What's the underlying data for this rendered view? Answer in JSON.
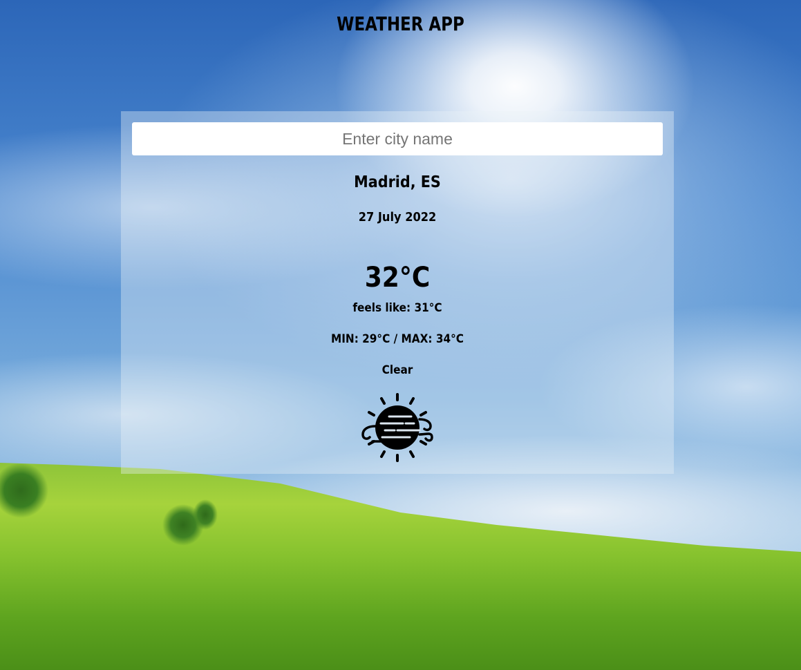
{
  "app": {
    "title": "WEATHER APP"
  },
  "search": {
    "placeholder": "Enter city name",
    "value": ""
  },
  "weather": {
    "location": "Madrid, ES",
    "date": "27 July 2022",
    "temperature": "32°C",
    "feels_like": "feels like: 31°C",
    "min_max": "MIN: 29°C / MAX: 34°C",
    "description": "Clear",
    "icon": "sun-haze-icon"
  },
  "colors": {
    "text": "#000000",
    "card_background": "rgba(235,242,248,0.38)",
    "input_background": "#ffffff"
  }
}
